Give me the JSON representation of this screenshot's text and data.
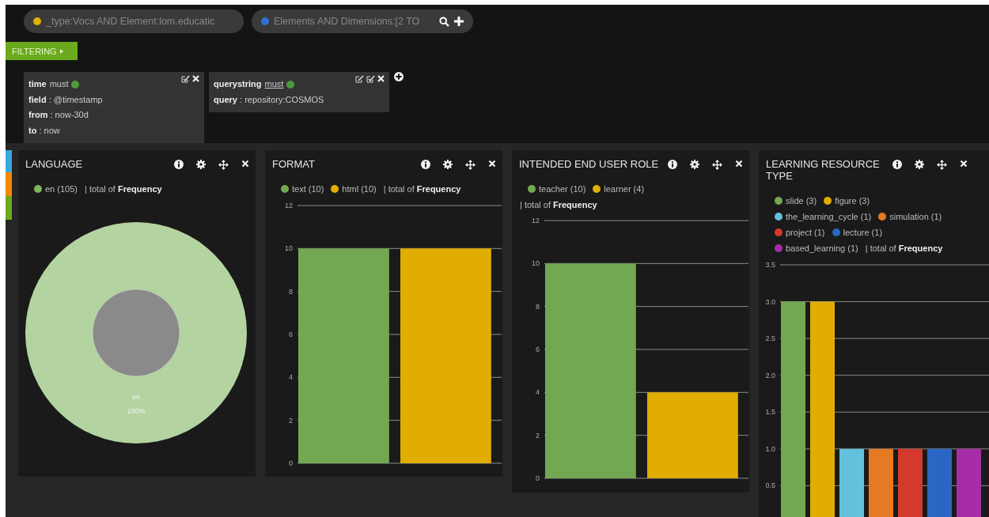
{
  "queries": [
    {
      "text": "_type:Vocs AND Element:lom.educatic",
      "color": "#e0b000"
    },
    {
      "text": "Elements AND Dimensions:[2 TO",
      "color": "#2f6fd6"
    }
  ],
  "filtering": {
    "label": "FILTERING"
  },
  "filters": [
    {
      "name": "time",
      "mode": "must",
      "mode_link": false,
      "active": true,
      "fields": [
        "**field** : @timestamp",
        "**from** : now-30d",
        "**to** : now"
      ],
      "editable": false
    },
    {
      "name": "querystring",
      "mode": "must",
      "mode_link": true,
      "active": true,
      "fields": [
        "**query** : repository:COSMOS"
      ],
      "editable": true
    }
  ],
  "panels": [
    {
      "title": "LANGUAGE",
      "legend_rows": [
        [
          {
            "kind": "series",
            "label": "en (105)",
            "color": "#7cb65a"
          },
          {
            "kind": "total",
            "text": "| total of **Frequency**"
          }
        ]
      ],
      "chart_data": {
        "type": "donut",
        "categories": [
          "en"
        ],
        "values": [
          100
        ],
        "value_labels": [
          "100%"
        ]
      }
    },
    {
      "title": "FORMAT",
      "legend_rows": [
        [
          {
            "kind": "series",
            "label": "text (10)",
            "color": "#72a852"
          },
          {
            "kind": "series",
            "label": "html (10)",
            "color": "#e0ad00"
          },
          {
            "kind": "total",
            "text": "| total of **Frequency**"
          }
        ]
      ],
      "chart_data": {
        "type": "bar",
        "values": [
          10,
          10
        ],
        "ylim": [
          0,
          12
        ],
        "yticks": [
          0,
          2,
          4,
          6,
          8,
          10,
          12
        ],
        "grid": true
      }
    },
    {
      "title": "INTENDED END USER ROLE",
      "legend_rows": [
        [
          {
            "kind": "series",
            "label": "teacher (10)",
            "color": "#72a852"
          },
          {
            "kind": "series",
            "label": "learner (4)",
            "color": "#e0ad00"
          }
        ],
        [
          {
            "kind": "total",
            "text": "| total of **Frequency**"
          }
        ]
      ],
      "chart_data": {
        "type": "bar",
        "values": [
          10,
          4
        ],
        "ylim": [
          0,
          12
        ],
        "yticks": [
          0,
          2,
          4,
          6,
          8,
          10,
          12
        ],
        "grid": true
      }
    },
    {
      "title": "LEARNING RESOURCE TYPE",
      "legend_rows": [
        [
          {
            "kind": "series",
            "label": "slide (3)",
            "color": "#72a852"
          },
          {
            "kind": "series",
            "label": "figure (3)",
            "color": "#e0ad00"
          }
        ],
        [
          {
            "kind": "series",
            "label": "the_learning_cycle (1)",
            "color": "#62c2dc"
          },
          {
            "kind": "series",
            "label": "simulation (1)",
            "color": "#e67a22"
          }
        ],
        [
          {
            "kind": "series",
            "label": "project (1)",
            "color": "#d33a2c"
          },
          {
            "kind": "series",
            "label": "lecture (1)",
            "color": "#2a66c4"
          }
        ],
        [
          {
            "kind": "series",
            "label": "based_learning (1)",
            "color": "#a62ca8"
          },
          {
            "kind": "total",
            "text": "| total of **Frequency**"
          }
        ]
      ],
      "chart_data": {
        "type": "bar",
        "values": [
          3,
          3,
          1,
          1,
          1,
          1,
          1
        ],
        "grid": true,
        "ylim": [
          0,
          3.5
        ],
        "yticks": [
          {
            "value": 0.5,
            "label": "0.5"
          },
          {
            "value": 1,
            "label": "1.0"
          },
          {
            "value": 1.5,
            "label": "1.5"
          },
          {
            "value": 2,
            "label": "2.0"
          },
          {
            "value": 2.5,
            "label": "2.5"
          },
          {
            "value": 3,
            "label": "3.0"
          },
          {
            "value": 3.5,
            "label": "3.5"
          }
        ]
      }
    }
  ]
}
